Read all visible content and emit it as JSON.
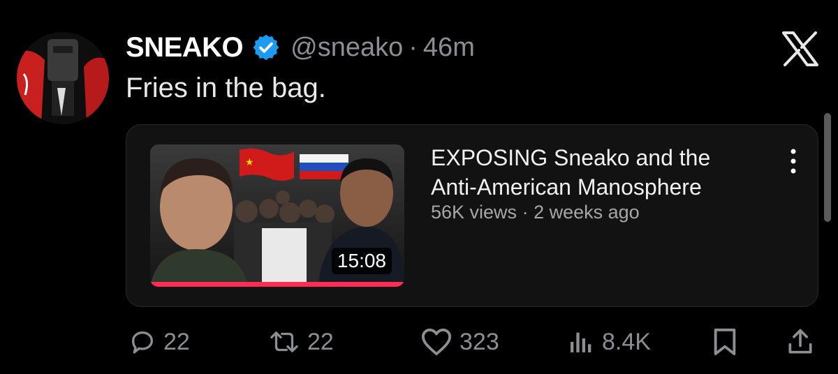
{
  "post": {
    "display_name": "SNEAKO",
    "handle": "@sneako",
    "separator": "·",
    "timestamp": "46m",
    "text": "Fries in the bag."
  },
  "video_card": {
    "title": "EXPOSING Sneako and the Anti-American Manosphere",
    "views": "56K views",
    "meta_separator": " · ",
    "uploaded": "2 weeks ago",
    "duration": "15:08",
    "watch_progress": 1.0
  },
  "actions": {
    "replies": "22",
    "reposts": "22",
    "likes": "323",
    "views": "8.4K"
  },
  "icons": {
    "verified": "verified-badge-icon",
    "logo": "x-logo-icon",
    "more": "kebab-menu-icon",
    "reply": "reply-icon",
    "repost": "repost-icon",
    "like": "heart-icon",
    "views": "views-chart-icon",
    "bookmark": "bookmark-icon",
    "share": "share-icon"
  },
  "colors": {
    "background": "#000000",
    "text": "#e7e9ea",
    "muted": "#8b8f94",
    "verified": "#1d9bf0",
    "progress": "#ff2d55"
  }
}
